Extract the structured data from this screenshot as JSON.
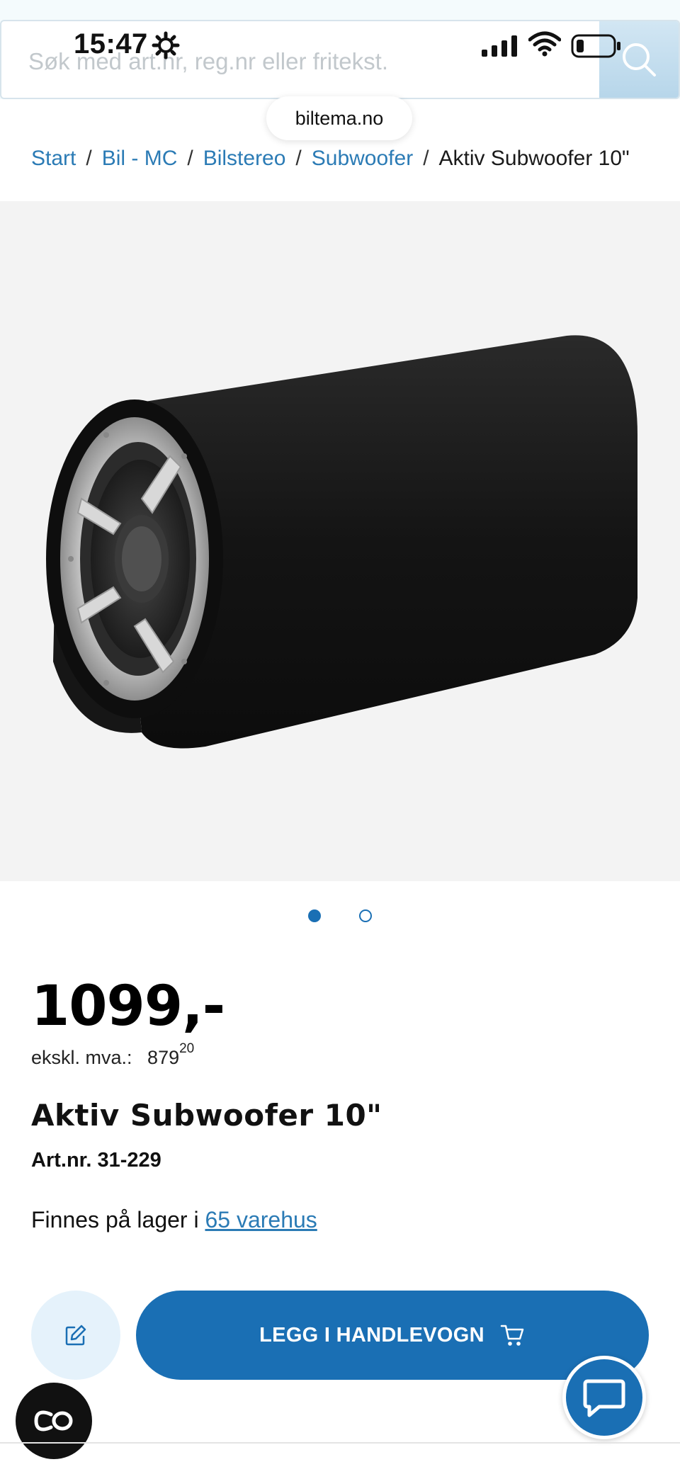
{
  "status_bar": {
    "time": "15:47"
  },
  "search": {
    "placeholder": "Søk med art.nr, reg.nr eller fritekst."
  },
  "browser": {
    "url": "biltema.no"
  },
  "breadcrumb": {
    "items": [
      "Start",
      "Bil - MC",
      "Bilstereo",
      "Subwoofer"
    ],
    "separator": "/",
    "current": "Aktiv Subwoofer 10\""
  },
  "gallery": {
    "total_images": 2,
    "active_index": 0
  },
  "product": {
    "price": "1099,-",
    "ex_vat_label": "ekskl. mva.:",
    "ex_vat_main": "879",
    "ex_vat_cents": "20",
    "title": "Aktiv Subwoofer 10\"",
    "art_nr": "Art.nr. 31-229",
    "stock_prefix": "Finnes på lager i ",
    "stock_link": "65 varehus"
  },
  "actions": {
    "add_to_cart_label": "LEGG I HANDLEVOGN"
  },
  "colors": {
    "brand_blue": "#1a6fb4",
    "link_blue": "#2b7bb5",
    "image_bg": "#f3f3f3"
  },
  "icons": {
    "search": "search-icon",
    "note": "edit-note-icon",
    "cart": "cart-icon",
    "chat": "chat-icon",
    "co": "co-icon",
    "gear": "gear-icon"
  }
}
